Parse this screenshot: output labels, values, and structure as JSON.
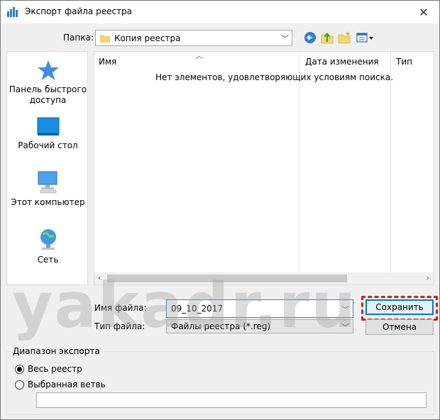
{
  "window": {
    "title": "Экспорт файла реестра",
    "close_glyph": "✕"
  },
  "toolbar": {
    "folder_label": "Папка:",
    "current_folder": "Копия реестра",
    "back_icon": "back-arrow-icon",
    "up_icon": "up-folder-icon",
    "new_folder_icon": "new-folder-icon",
    "views_icon": "views-menu-icon"
  },
  "places": [
    {
      "label": "Панель быстрого доступа",
      "icon": "star-icon"
    },
    {
      "label": "Рабочий стол",
      "icon": "desktop-icon"
    },
    {
      "label": "Этот компьютер",
      "icon": "computer-icon"
    },
    {
      "label": "Сеть",
      "icon": "network-icon"
    }
  ],
  "file_list": {
    "columns": [
      "Имя",
      "Дата изменения",
      "Тип"
    ],
    "empty_message": "Нет элементов, удовлетворяющих условиям поиска."
  },
  "form": {
    "filename_label": "Имя файла:",
    "filename_value": "09_10_2017",
    "filetype_label": "Тип файла:",
    "filetype_value": "Файлы реестра (*.reg)",
    "save_label": "Сохранить",
    "cancel_label": "Отмена"
  },
  "export_range": {
    "group_label": "Диапазон экспорта",
    "option_all": "Весь реестр",
    "option_branch": "Выбранная ветвь",
    "branch_value": ""
  },
  "watermark": "yakadr.ru",
  "colors": {
    "accent": "#0078d7",
    "highlight": "#c0262d"
  }
}
